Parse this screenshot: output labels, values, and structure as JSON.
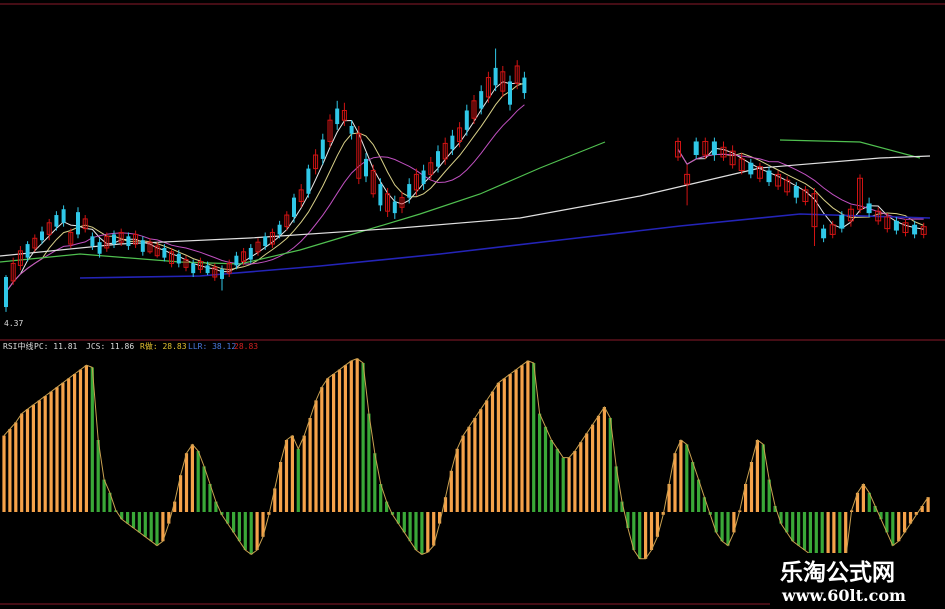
{
  "chart_data": [
    {
      "type": "candlestick",
      "low_label": "4.37",
      "colors": {
        "up": "#d11313",
        "down": "#30c8e8",
        "low_label": "#dddddd",
        "ma5": "#e8e8e8",
        "ma10": "#d8d088",
        "ma20": "#c050c0",
        "ma60": "#50c050",
        "ma120": "#e0e0e0",
        "ma250": "#2424b8"
      },
      "y_domain": [
        0,
        345
      ],
      "candles": [
        [
          1,
          0,
          282,
          313,
          280,
          318
        ],
        [
          2,
          1,
          268,
          286,
          262,
          290
        ],
        [
          3,
          1,
          255,
          270,
          250,
          275
        ],
        [
          4,
          0,
          248,
          262,
          245,
          266
        ],
        [
          5,
          1,
          242,
          252,
          238,
          256
        ],
        [
          6,
          0,
          235,
          244,
          230,
          248
        ],
        [
          7,
          1,
          226,
          238,
          222,
          244
        ],
        [
          8,
          0,
          218,
          230,
          214,
          234
        ],
        [
          9,
          0,
          212,
          226,
          208,
          230
        ],
        [
          10,
          1,
          236,
          248,
          232,
          252
        ],
        [
          11,
          0,
          215,
          238,
          210,
          242
        ],
        [
          12,
          1,
          222,
          232,
          218,
          236
        ],
        [
          13,
          0,
          240,
          250,
          236,
          254
        ],
        [
          14,
          0,
          246,
          258,
          242,
          262
        ],
        [
          15,
          1,
          240,
          252,
          236,
          256
        ],
        [
          16,
          0,
          238,
          248,
          234,
          252
        ],
        [
          17,
          1,
          236,
          246,
          232,
          250
        ],
        [
          18,
          0,
          240,
          250,
          236,
          254
        ],
        [
          19,
          1,
          238,
          248,
          234,
          252
        ],
        [
          20,
          0,
          244,
          256,
          240,
          260
        ],
        [
          21,
          1,
          246,
          256,
          242,
          258
        ],
        [
          22,
          1,
          250,
          260,
          246,
          262
        ],
        [
          23,
          0,
          252,
          262,
          248,
          266
        ],
        [
          24,
          1,
          256,
          268,
          252,
          272
        ],
        [
          25,
          0,
          258,
          268,
          254,
          272
        ],
        [
          26,
          1,
          264,
          272,
          260,
          276
        ],
        [
          27,
          0,
          268,
          278,
          264,
          282
        ],
        [
          28,
          1,
          266,
          274,
          262,
          278
        ],
        [
          29,
          0,
          270,
          278,
          266,
          280
        ],
        [
          30,
          1,
          272,
          282,
          268,
          286
        ],
        [
          31,
          0,
          274,
          284,
          270,
          296
        ],
        [
          32,
          1,
          268,
          278,
          264,
          282
        ],
        [
          33,
          0,
          260,
          270,
          256,
          274
        ],
        [
          34,
          1,
          256,
          266,
          252,
          270
        ],
        [
          35,
          0,
          252,
          264,
          248,
          268
        ],
        [
          36,
          1,
          246,
          256,
          242,
          260
        ],
        [
          37,
          0,
          240,
          250,
          236,
          254
        ],
        [
          38,
          1,
          236,
          248,
          232,
          252
        ],
        [
          39,
          0,
          228,
          238,
          224,
          242
        ],
        [
          40,
          1,
          218,
          230,
          214,
          234
        ],
        [
          41,
          0,
          200,
          220,
          196,
          226
        ],
        [
          42,
          1,
          192,
          204,
          186,
          210
        ],
        [
          43,
          0,
          170,
          196,
          166,
          200
        ],
        [
          44,
          1,
          156,
          170,
          150,
          176
        ],
        [
          45,
          0,
          140,
          160,
          134,
          166
        ],
        [
          46,
          1,
          120,
          142,
          114,
          148
        ],
        [
          47,
          0,
          108,
          124,
          100,
          130
        ],
        [
          48,
          1,
          110,
          120,
          102,
          126
        ],
        [
          49,
          0,
          126,
          134,
          120,
          140
        ],
        [
          50,
          1,
          134,
          180,
          126,
          186
        ],
        [
          51,
          0,
          160,
          178,
          154,
          184
        ],
        [
          52,
          1,
          172,
          196,
          166,
          200
        ],
        [
          53,
          0,
          186,
          208,
          180,
          214
        ],
        [
          54,
          1,
          196,
          214,
          190,
          220
        ],
        [
          55,
          0,
          204,
          216,
          198,
          222
        ],
        [
          56,
          1,
          200,
          210,
          194,
          216
        ],
        [
          57,
          0,
          186,
          200,
          180,
          206
        ],
        [
          58,
          1,
          176,
          192,
          170,
          198
        ],
        [
          59,
          0,
          172,
          186,
          166,
          192
        ],
        [
          60,
          1,
          164,
          176,
          158,
          182
        ],
        [
          61,
          0,
          152,
          168,
          146,
          174
        ],
        [
          62,
          1,
          144,
          160,
          138,
          166
        ],
        [
          63,
          0,
          136,
          150,
          130,
          156
        ],
        [
          64,
          1,
          128,
          142,
          122,
          148
        ],
        [
          65,
          0,
          110,
          130,
          104,
          136
        ],
        [
          66,
          1,
          100,
          118,
          94,
          124
        ],
        [
          67,
          0,
          90,
          108,
          84,
          114
        ],
        [
          68,
          1,
          76,
          96,
          70,
          102
        ],
        [
          69,
          0,
          66,
          84,
          46,
          90
        ],
        [
          70,
          1,
          70,
          90,
          64,
          96
        ],
        [
          71,
          0,
          80,
          104,
          74,
          110
        ],
        [
          72,
          1,
          64,
          82,
          58,
          88
        ],
        [
          73,
          0,
          76,
          92,
          70,
          98
        ]
      ],
      "candles_right": [
        [
          1,
          1,
          142,
          158,
          138,
          162
        ],
        [
          2,
          1,
          176,
          186,
          166,
          208
        ],
        [
          3,
          0,
          142,
          156,
          138,
          160
        ],
        [
          4,
          1,
          142,
          156,
          138,
          160
        ],
        [
          5,
          0,
          142,
          156,
          138,
          162
        ],
        [
          6,
          1,
          148,
          158,
          142,
          162
        ],
        [
          7,
          1,
          152,
          166,
          146,
          170
        ],
        [
          8,
          1,
          160,
          172,
          154,
          176
        ],
        [
          9,
          0,
          164,
          176,
          160,
          180
        ],
        [
          10,
          1,
          168,
          180,
          164,
          184
        ],
        [
          11,
          0,
          172,
          184,
          168,
          188
        ],
        [
          12,
          1,
          176,
          188,
          172,
          192
        ],
        [
          13,
          1,
          182,
          194,
          178,
          198
        ],
        [
          14,
          0,
          188,
          200,
          184,
          206
        ],
        [
          15,
          1,
          192,
          204,
          188,
          208
        ],
        [
          16,
          1,
          196,
          230,
          190,
          250
        ],
        [
          17,
          0,
          232,
          242,
          228,
          246
        ],
        [
          18,
          1,
          228,
          238,
          224,
          242
        ],
        [
          19,
          0,
          218,
          232,
          214,
          236
        ],
        [
          20,
          1,
          212,
          224,
          208,
          230
        ],
        [
          21,
          1,
          180,
          212,
          176,
          216
        ],
        [
          22,
          0,
          206,
          216,
          200,
          220
        ],
        [
          23,
          1,
          214,
          224,
          210,
          228
        ],
        [
          24,
          1,
          220,
          232,
          216,
          236
        ],
        [
          25,
          0,
          224,
          234,
          220,
          238
        ],
        [
          26,
          1,
          226,
          236,
          222,
          240
        ],
        [
          27,
          0,
          228,
          238,
          224,
          242
        ],
        [
          28,
          1,
          230,
          238,
          226,
          242
        ]
      ]
    },
    {
      "type": "bar",
      "title": "RSI中线",
      "legend": [
        {
          "text": "PC: 11.81",
          "color": "#dddddd"
        },
        {
          "text": "JCS: 11.86",
          "color": "#dddddd"
        },
        {
          "text": "R做: 28.83",
          "color": "#e0c030"
        },
        {
          "text": "LLR: 38.12",
          "color": "#4a7ae0"
        },
        {
          "text": "28.83",
          "color": "#d02020"
        }
      ],
      "series": [
        {
          "name": "RSI",
          "color_up": "#f5a24a",
          "color_down": "#3aa838",
          "values": [
            62,
            65,
            68,
            72,
            74,
            76,
            78,
            80,
            82,
            84,
            86,
            88,
            90,
            92,
            94,
            93,
            60,
            42,
            36,
            28,
            24,
            22,
            20,
            18,
            16,
            14,
            12,
            14,
            22,
            32,
            44,
            54,
            58,
            55,
            48,
            40,
            32,
            26,
            22,
            18,
            14,
            10,
            8,
            10,
            16,
            26,
            38,
            50,
            60,
            62,
            56,
            62,
            70,
            78,
            84,
            88,
            90,
            92,
            94,
            96,
            97,
            95,
            72,
            54,
            40,
            32,
            26,
            22,
            18,
            14,
            10,
            8,
            9,
            12,
            22,
            34,
            46,
            56,
            62,
            66,
            70,
            74,
            78,
            82,
            86,
            88,
            90,
            92,
            94,
            96,
            95,
            72,
            66,
            60,
            56,
            52,
            52,
            55,
            59,
            63,
            67,
            71,
            75,
            70,
            48,
            32,
            20,
            10,
            6,
            6,
            10,
            16,
            26,
            40,
            54,
            60,
            58,
            50,
            42,
            34,
            26,
            18,
            14,
            12,
            18,
            28,
            40,
            50,
            60,
            58,
            42,
            30,
            22,
            18,
            14,
            12,
            10,
            8,
            7,
            6,
            6,
            6,
            5,
            6,
            28,
            36,
            40,
            36,
            30,
            24,
            18,
            12,
            14,
            18,
            22,
            26,
            30,
            34
          ]
        }
      ]
    }
  ],
  "watermark": {
    "title": "乐淘公式网",
    "url": "www.60lt.com"
  }
}
